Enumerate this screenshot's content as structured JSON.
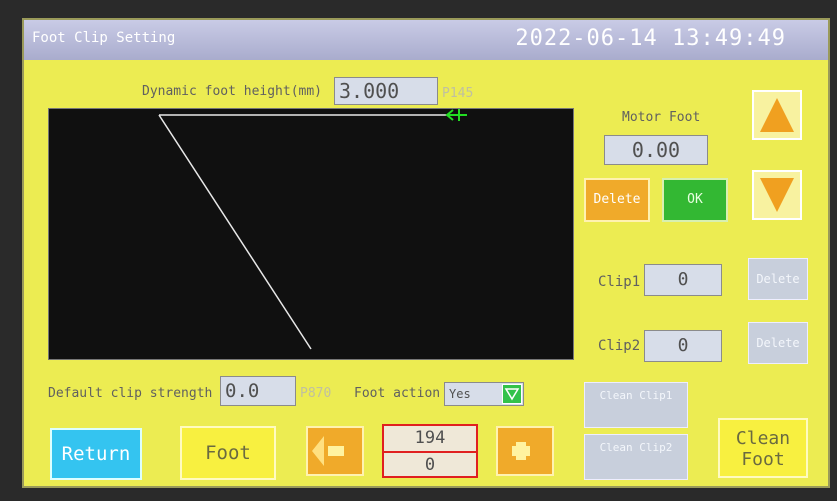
{
  "window": {
    "title": "Foot Clip Setting",
    "datetime": "2022-06-14 13:49:49"
  },
  "dynamic_foot": {
    "label": "Dynamic foot height(mm)",
    "value": "3.000",
    "param": "P145"
  },
  "motor_foot": {
    "label": "Motor Foot",
    "value": "0.00"
  },
  "buttons": {
    "delete": "Delete",
    "ok": "OK",
    "return": "Return",
    "foot": "Foot",
    "clean_clip1": "Clean Clip1",
    "clean_clip2": "Clean Clip2",
    "clean_foot": "Clean Foot"
  },
  "clip1": {
    "label": "Clip1",
    "value": "0",
    "delete": "Delete"
  },
  "clip2": {
    "label": "Clip2",
    "value": "0",
    "delete": "Delete"
  },
  "default_clip": {
    "label": "Default clip strength",
    "value": "0.0",
    "param": "P870"
  },
  "foot_action": {
    "label": "Foot action",
    "value": "Yes"
  },
  "counter": {
    "current": "194",
    "total": "0"
  },
  "colors": {
    "screen": "#ecec52",
    "accent_orange": "#f0aa2a",
    "ok_green": "#33b833",
    "return_cyan": "#34c4f0",
    "counter_border": "#e02020"
  },
  "icons": [
    "up-arrow-icon",
    "down-arrow-icon",
    "left-arrow-icon",
    "right-arrow-icon",
    "dropdown-icon",
    "needle-cursor-icon"
  ]
}
